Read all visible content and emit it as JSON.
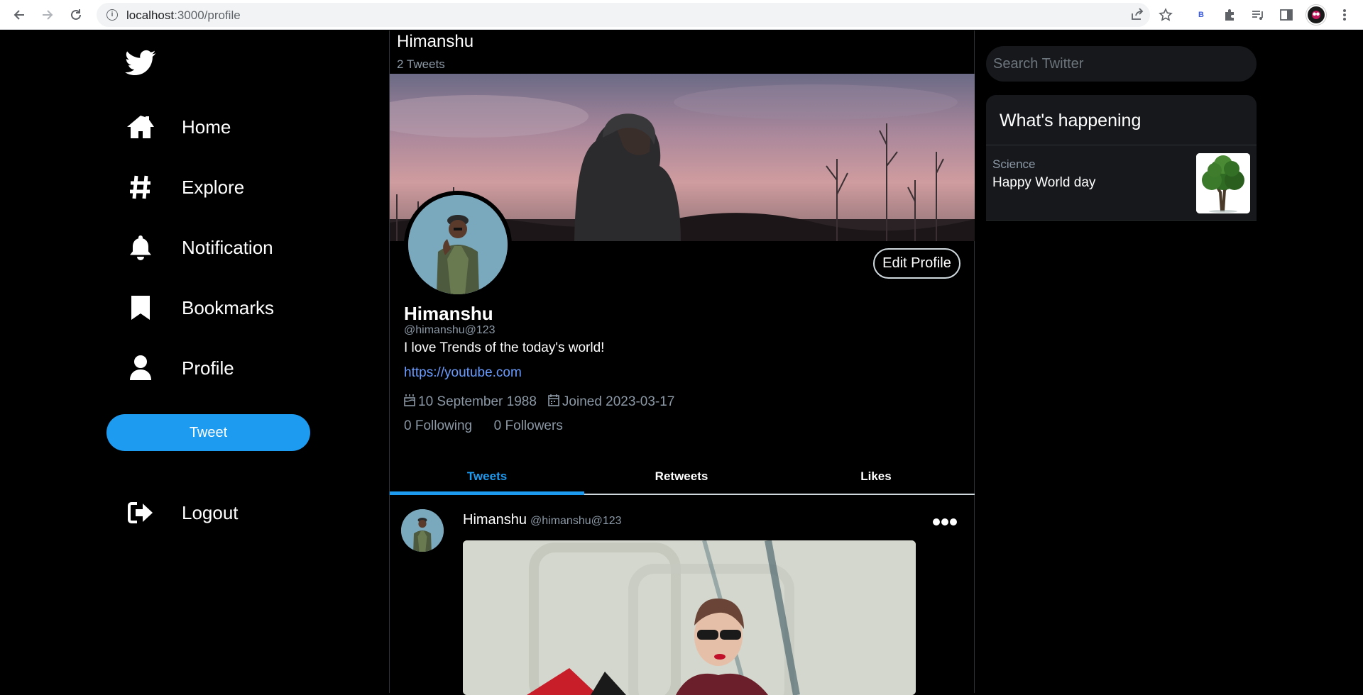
{
  "browser": {
    "url_host": "localhost",
    "url_path": ":3000/profile"
  },
  "sidebar": {
    "items": [
      {
        "label": "Home"
      },
      {
        "label": "Explore"
      },
      {
        "label": "Notification"
      },
      {
        "label": "Bookmarks"
      },
      {
        "label": "Profile"
      }
    ],
    "tweet_button": "Tweet",
    "logout": "Logout"
  },
  "header": {
    "name": "Himanshu",
    "tweet_count": "2 Tweets"
  },
  "profile": {
    "edit_button": "Edit Profile",
    "name": "Himanshu",
    "handle": "@himanshu@123",
    "bio": "I love Trends of the today's world!",
    "link": "https://youtube.com",
    "birthday": "10 September 1988",
    "joined": "Joined 2023-03-17",
    "following": "0 Following",
    "followers": "0 Followers"
  },
  "tabs": [
    {
      "label": "Tweets",
      "active": true
    },
    {
      "label": "Retweets",
      "active": false
    },
    {
      "label": "Likes",
      "active": false
    }
  ],
  "post": {
    "name": "Himanshu",
    "handle": "@himanshu@123",
    "more_icon": "more-dots-icon"
  },
  "right": {
    "search_placeholder": "Search Twitter",
    "trends_title": "What's happening",
    "trend": {
      "category": "Science",
      "title": "Happy World day"
    }
  },
  "colors": {
    "accent": "#1d9bf0",
    "link": "#6a9cff",
    "muted": "#8b98a5"
  }
}
